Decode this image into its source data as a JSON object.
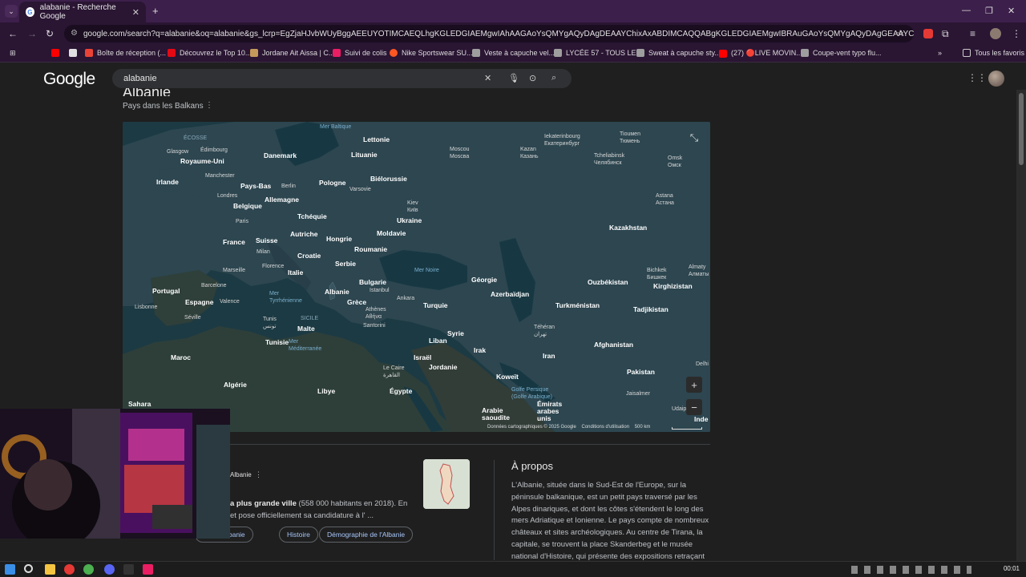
{
  "browser": {
    "tab_title": "alabanie - Recherche Google",
    "url": "google.com/search?q=alabanie&oq=alabanie&gs_lcrp=EgZjaHJvbWUyBggAEEUYOTIMCAEQLhgKGLEDGIAEMgwIAhAAGAoYsQMYgAQyDAgDEAAYChixAxABDIMCAQQABgKGLEDGIAEMgwIBRAuGAoYsQMYgAQyDAgGEAAYChixAxABDISCAcQA..."
  },
  "bookmarks": {
    "items": [
      {
        "label": "Boîte de réception (...",
        "color": "#ea4335"
      },
      {
        "label": "Découvrez le Top 10...",
        "color": "#e50914"
      },
      {
        "label": "Jordane Ait Aissa | C...",
        "color": "#c49a5a"
      },
      {
        "label": "Suivi de colis",
        "color": "#e91e63"
      },
      {
        "label": "Nike Sportswear SU...",
        "color": "#ff5722"
      },
      {
        "label": "Veste à capuche vel...",
        "color": "#9e9e9e"
      },
      {
        "label": "LYCÉE 57 - TOUS LE...",
        "color": "#9e9e9e"
      },
      {
        "label": "Sweat à capuche sty...",
        "color": "#9e9e9e"
      },
      {
        "label": "(27) 🔴LIVE MOVIN...",
        "color": "#ff0000"
      },
      {
        "label": "Coupe-vent typo flu...",
        "color": "#9e9e9e"
      }
    ],
    "all_favorites": "Tous les favoris"
  },
  "google": {
    "logo": "Google",
    "query": "alabanie"
  },
  "entity": {
    "title": "Albanie",
    "subtitle": "Pays dans les Balkans"
  },
  "map": {
    "labels": {
      "countries": [
        "Lettonie",
        "Danemark",
        "Lituanie",
        "Royaume-Uni",
        "Irlande",
        "Pays-Bas",
        "Biélorussie",
        "Pologne",
        "Allemagne",
        "Belgique",
        "Ukraine",
        "Tchéquie",
        "France",
        "Suisse",
        "Autriche",
        "Hongrie",
        "Moldavie",
        "Roumanie",
        "Croatie",
        "Serbie",
        "Italie",
        "Bulgarie",
        "Portugal",
        "Espagne",
        "Albanie",
        "Grèce",
        "Géorgie",
        "Azerbaïdjan",
        "Turquie",
        "Kazakhstan",
        "Ouzbékistan",
        "Kirghizistan",
        "Turkménistan",
        "Tadjikistan",
        "Syrie",
        "Liban",
        "Irak",
        "Iran",
        "Afghanistan",
        "Israël",
        "Jordanie",
        "Koweït",
        "Pakistan",
        "Malte",
        "Tunisie",
        "Maroc",
        "Algérie",
        "Libye",
        "Égypte",
        "Arabie saoudite",
        "Émirats arabes unis",
        "Sahara",
        "Inde"
      ],
      "cities": [
        "Glasgow",
        "Édimbourg",
        "Manchester",
        "Londres",
        "Berlin",
        "Varsovie",
        "Moscou\nMoscва",
        "Kazan\nКазань",
        "Iekaterinbourg\nЕкатеринбург",
        "Tiouмen\nТюмень",
        "Tcheliabinsk\nЧелябинск",
        "Omsk\nОмск",
        "Astana\nАстана",
        "Kiev\nКиїв",
        "Paris",
        "Milan",
        "Florence",
        "Marseille",
        "Barcelone",
        "Valence",
        "Lisbonne",
        "Séville",
        "Istanbul",
        "Ankara",
        "Athènes\nΑθήνα",
        "Santorini",
        "Tunis\nتونس",
        "Téhéran\nتهران",
        "Bichkek\nБишкек",
        "Almaty\nАлматы",
        "Le Caire\nالقاهرة",
        "Jaisalmer",
        "Udaip",
        "Delhi"
      ],
      "waters": [
        "Mer Baltique",
        "Mer Noire",
        "Mer Tyrrhénienne",
        "Mer Méditerranée",
        "Golfe Persique\n(Golfe Arabique)",
        "SICILE",
        "ÉCOSSE"
      ]
    },
    "attribution": "Données cartographiques © 2025 Google",
    "terms": "Conditions d'utilisation",
    "scale": "500 km"
  },
  "about": {
    "title": "À propos",
    "text": "L'Albanie, située dans le Sud-Est de l'Europe, sur la péninsule balkanique, est un petit pays traversé par les Alpes dinariques, et dont les côtes s'étendent le long des mers Adriatique et Ionienne. Le pays compte de nombreux châteaux et sites archéologiques. Au centre de Tirana, la capitale, se trouvent la place Skanderbeg et le musée national d'Histoire, qui présente des expositions retraçant"
  },
  "snippet": {
    "source": "Albanie",
    "bold": "a plus grande ville",
    "text": " (558 000 habitants en 2018). En",
    "text2": "et pose officiellement sa candidature à l' ..."
  },
  "chips": [
    "ie de l'Albanie",
    "Histoire",
    "Démographie de l'Albanie"
  ],
  "taskbar": {
    "time": "00:01"
  }
}
